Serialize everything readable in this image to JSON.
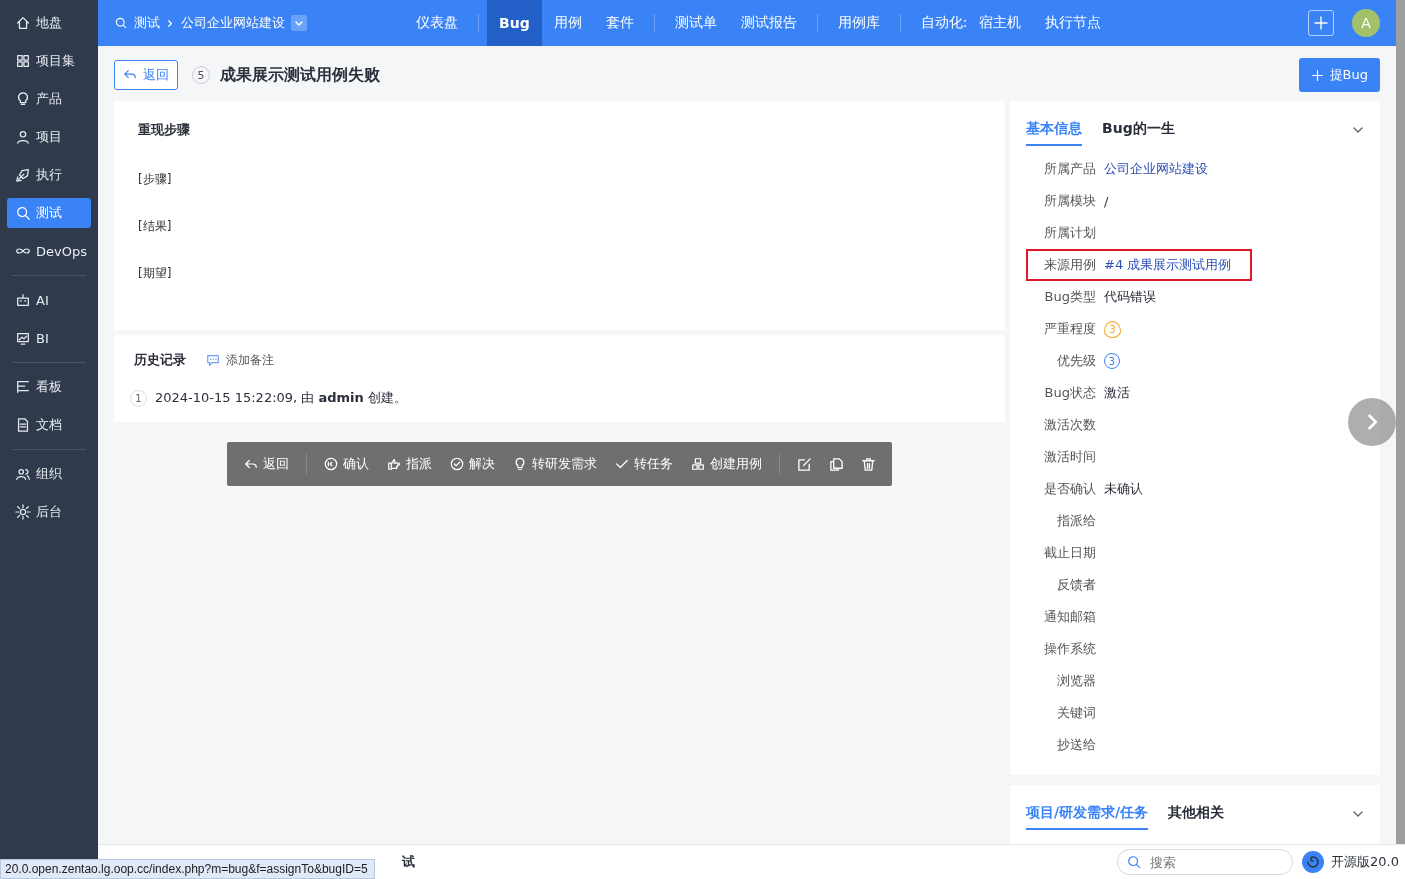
{
  "sidebar": {
    "groups": [
      [
        {
          "label": "地盘",
          "selected": false
        },
        {
          "label": "项目集",
          "selected": false
        },
        {
          "label": "产品",
          "selected": false
        },
        {
          "label": "项目",
          "selected": false
        },
        {
          "label": "执行",
          "selected": false
        },
        {
          "label": "测试",
          "selected": true
        },
        {
          "label": "DevOps",
          "selected": false
        }
      ],
      [
        {
          "label": "AI",
          "selected": false
        },
        {
          "label": "BI",
          "selected": false
        }
      ],
      [
        {
          "label": "看板",
          "selected": false
        },
        {
          "label": "文档",
          "selected": false
        }
      ],
      [
        {
          "label": "组织",
          "selected": false
        },
        {
          "label": "后台",
          "selected": false
        }
      ]
    ]
  },
  "topbar": {
    "breadcrumb": [
      "测试",
      "公司企业网站建设"
    ],
    "nav_groups": [
      [
        {
          "label": "仪表盘",
          "kind": "link",
          "selected": false
        }
      ],
      [
        {
          "label": "Bug",
          "kind": "link",
          "selected": true
        },
        {
          "label": "用例",
          "kind": "link",
          "selected": false
        },
        {
          "label": "套件",
          "kind": "link",
          "selected": false
        }
      ],
      [
        {
          "label": "测试单",
          "kind": "link",
          "selected": false
        },
        {
          "label": "测试报告",
          "kind": "link",
          "selected": false
        }
      ],
      [
        {
          "label": "用例库",
          "kind": "link",
          "selected": false
        }
      ],
      [
        {
          "label": "自动化:",
          "kind": "label"
        },
        {
          "label": "宿主机",
          "kind": "link",
          "selected": false
        },
        {
          "label": "执行节点",
          "kind": "link",
          "selected": false
        }
      ]
    ],
    "avatar": "A"
  },
  "header": {
    "back_button": "返回",
    "bug_id": "5",
    "title": "成果展示测试用例失败",
    "create_button": "提Bug"
  },
  "steps": {
    "heading": "重现步骤",
    "lines": [
      "[步骤]",
      "[结果]",
      "[期望]"
    ]
  },
  "history": {
    "heading": "历史记录",
    "add_note": "添加备注",
    "entries": [
      {
        "number": "1",
        "text": "2024-10-15 15:22:09, 由 **admin** 创建。"
      }
    ]
  },
  "toolbar": {
    "buttons": [
      "返回",
      "确认",
      "指派",
      "解决",
      "转研发需求",
      "转任务",
      "创建用例"
    ]
  },
  "info_panel": {
    "tabs": [
      {
        "label": "基本信息",
        "selected": true
      },
      {
        "label": "Bug的一生",
        "selected": false
      }
    ],
    "fields": [
      {
        "label": "所属产品",
        "value": "公司企业网站建设",
        "kind": "link",
        "highlighted": false
      },
      {
        "label": "所属模块",
        "value": "/",
        "kind": "text",
        "highlighted": false
      },
      {
        "label": "所属计划",
        "highlighted": false
      },
      {
        "label": "来源用例",
        "value": "#4 成果展示测试用例",
        "kind": "link",
        "highlighted": true
      },
      {
        "label": "Bug类型",
        "value": "代码错误",
        "kind": "text",
        "highlighted": false
      },
      {
        "label": "严重程度",
        "value": "3",
        "kind": "severity",
        "highlighted": false
      },
      {
        "label": "优先级",
        "value": "3",
        "kind": "priority",
        "highlighted": false
      },
      {
        "label": "Bug状态",
        "value": "激活",
        "kind": "text",
        "highlighted": false
      },
      {
        "label": "激活次数",
        "highlighted": false
      },
      {
        "label": "激活时间",
        "highlighted": false
      },
      {
        "label": "是否确认",
        "value": "未确认",
        "kind": "text",
        "highlighted": false
      },
      {
        "label": "指派给",
        "highlighted": false
      },
      {
        "label": "截止日期",
        "highlighted": false
      },
      {
        "label": "反馈者",
        "highlighted": false
      },
      {
        "label": "通知邮箱",
        "highlighted": false
      },
      {
        "label": "操作系统",
        "highlighted": false
      },
      {
        "label": "浏览器",
        "highlighted": false
      },
      {
        "label": "关键词",
        "highlighted": false
      },
      {
        "label": "抄送给",
        "highlighted": false
      }
    ]
  },
  "related_panel": {
    "tabs": [
      {
        "label": "项目/研发需求/任务",
        "selected": true
      },
      {
        "label": "其他相关",
        "selected": false
      }
    ]
  },
  "bottom_bar": {
    "breadcrumb_current": "试",
    "search": {
      "placeholder": "搜索"
    },
    "version": "开源版20.0"
  },
  "status_url": "20.0.open.zentao.lg.oop.cc/index.php?m=bug&f=assignTo&bugID=5"
}
